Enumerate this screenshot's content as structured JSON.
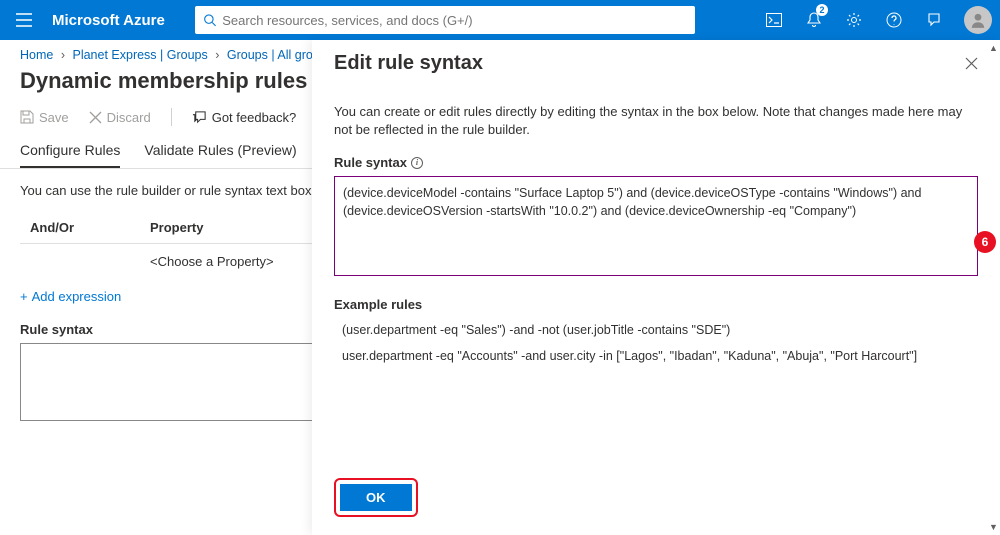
{
  "header": {
    "brand": "Microsoft Azure",
    "search_placeholder": "Search resources, services, and docs (G+/)",
    "notification_count": "2"
  },
  "breadcrumb": {
    "items": [
      "Home",
      "Planet Express | Groups",
      "Groups | All groups"
    ]
  },
  "page": {
    "title": "Dynamic membership rules",
    "more": "···"
  },
  "commands": {
    "save": "Save",
    "discard": "Discard",
    "feedback": "Got feedback?"
  },
  "tabs": {
    "configure": "Configure Rules",
    "validate": "Validate Rules (Preview)"
  },
  "rulebuilder": {
    "desc": "You can use the rule builder or rule syntax text box to create",
    "col_andor": "And/Or",
    "col_property": "Property",
    "choose_property": "<Choose a Property>",
    "add_expression": "Add expression",
    "rule_syntax_label": "Rule syntax"
  },
  "sidepanel": {
    "title": "Edit rule syntax",
    "desc": "You can create or edit rules directly by editing the syntax in the box below. Note that changes made here may not be reflected in the rule builder.",
    "rule_syntax_label": "Rule syntax",
    "rule_syntax_value": "(device.deviceModel -contains \"Surface Laptop 5\") and (device.deviceOSType -contains \"Windows\") and (device.deviceOSVersion -startsWith \"10.0.2\") and (device.deviceOwnership -eq \"Company\")",
    "example_label": "Example rules",
    "example1": "(user.department -eq \"Sales\") -and -not (user.jobTitle -contains \"SDE\")",
    "example2": "user.department -eq \"Accounts\" -and user.city -in [\"Lagos\", \"Ibadan\", \"Kaduna\", \"Abuja\", \"Port Harcourt\"]",
    "ok": "OK",
    "callout": "6"
  }
}
